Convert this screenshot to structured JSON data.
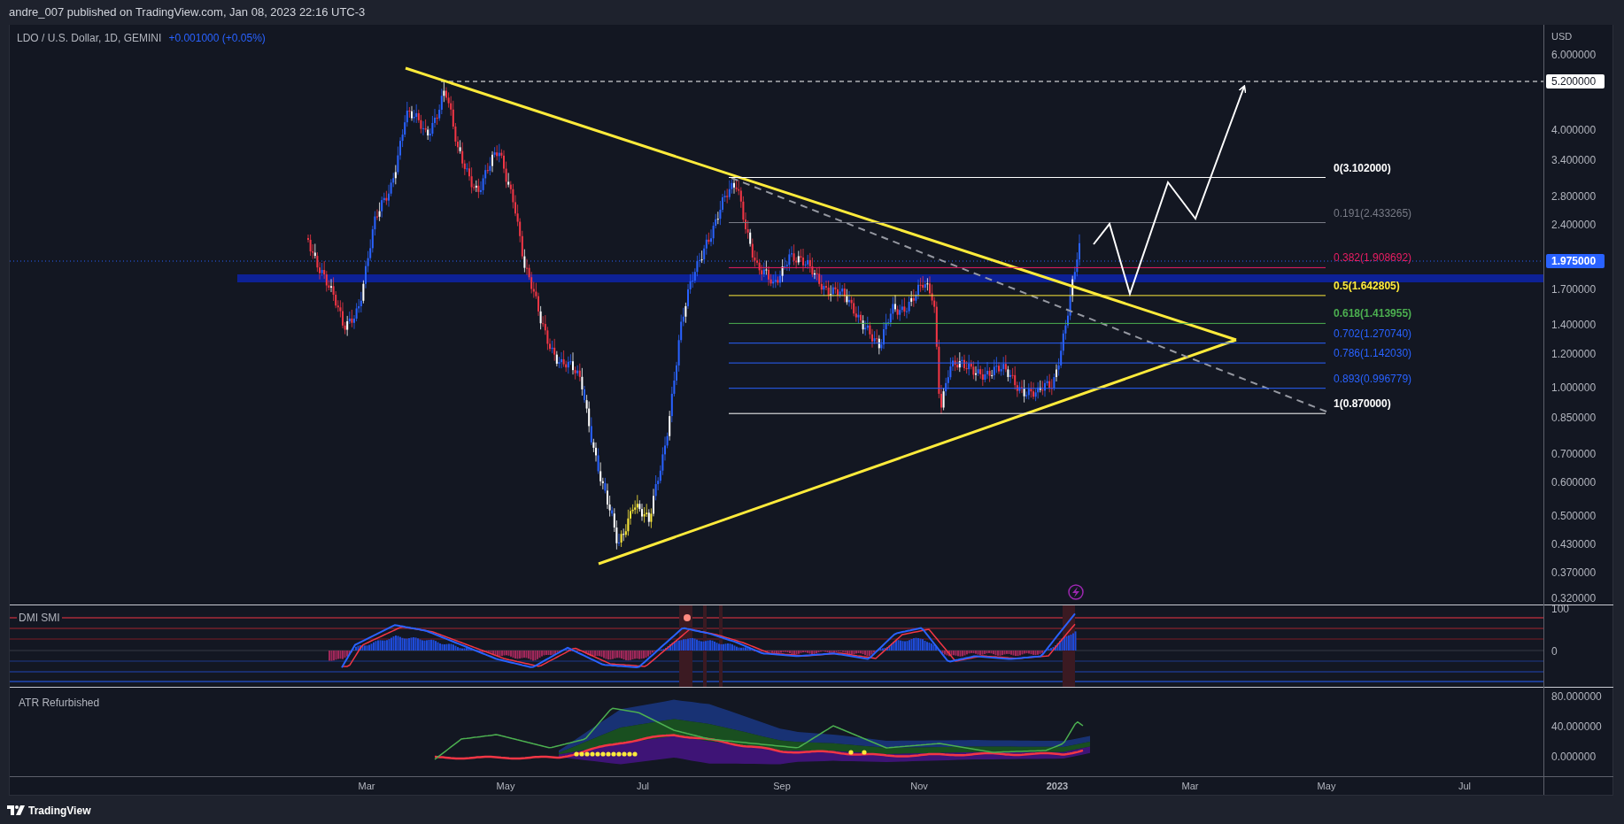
{
  "header": {
    "publisher_line": "andre_007 published on TradingView.com, Jan 08, 2023 22:16 UTC-3"
  },
  "legend": {
    "symbol": "LDO / U.S. Dollar, 1D, GEMINI",
    "change": "+0.001000 (+0.05%)"
  },
  "price_axis": {
    "unit": "USD",
    "labels": [
      "6.000000",
      "4.000000",
      "3.400000",
      "2.800000",
      "2.400000",
      "1.700000",
      "1.400000",
      "1.200000",
      "1.000000",
      "0.850000",
      "0.700000",
      "0.600000",
      "0.500000",
      "0.430000",
      "0.370000",
      "0.320000"
    ],
    "markers": [
      {
        "text": "5.200000",
        "kind": "target"
      },
      {
        "text": "1.975000",
        "kind": "last"
      }
    ]
  },
  "fib_levels": [
    {
      "label": "0(3.102000)",
      "color": "#ffffff",
      "bold": true
    },
    {
      "label": "0.191(2.433265)",
      "color": "#787b86",
      "bold": false
    },
    {
      "label": "0.382(1.908692)",
      "color": "#e91e63",
      "bold": false
    },
    {
      "label": "0.5(1.642805)",
      "color": "#ffeb3b",
      "bold": true
    },
    {
      "label": "0.618(1.413955)",
      "color": "#4caf50",
      "bold": true
    },
    {
      "label": "0.702(1.270740)",
      "color": "#2962ff",
      "bold": false
    },
    {
      "label": "0.786(1.142030)",
      "color": "#2962ff",
      "bold": false
    },
    {
      "label": "0.893(0.996779)",
      "color": "#2962ff",
      "bold": false
    },
    {
      "label": "1(0.870000)",
      "color": "#ffffff",
      "bold": true
    }
  ],
  "indicators": [
    {
      "title": "DMI SMI",
      "axis_labels": [
        "100",
        "0"
      ]
    },
    {
      "title": "ATR Refurbished",
      "axis_labels": [
        "80.000000",
        "40.000000",
        "0.000000"
      ]
    }
  ],
  "time_axis": {
    "labels": [
      "Mar",
      "May",
      "Jul",
      "Sep",
      "Nov",
      "2023",
      "Mar",
      "May",
      "Jul"
    ]
  },
  "footer": {
    "brand": "TradingView"
  }
}
